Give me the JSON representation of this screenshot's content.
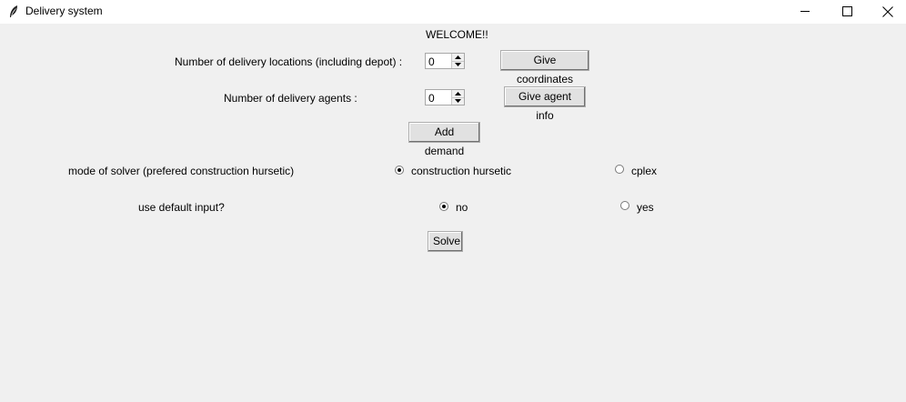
{
  "window": {
    "title": "Delivery system",
    "icon": "feather-icon",
    "controls": [
      "minimize-icon",
      "maximize-icon",
      "close-icon"
    ]
  },
  "welcome": "WELCOME!!",
  "locations": {
    "label": "Number of delivery locations (including depot) :",
    "value": "0",
    "button": "Give coordinates"
  },
  "agents": {
    "label": "Number of delivery agents :",
    "value": "0",
    "button": "Give agent info"
  },
  "add_demand_button": "Add demand",
  "solver_mode": {
    "label": "mode of solver (prefered construction hursetic)",
    "options": [
      {
        "label": "construction hursetic",
        "selected": true
      },
      {
        "label": "cplex",
        "selected": false
      }
    ]
  },
  "default_input": {
    "label": "use default input?",
    "options": [
      {
        "label": "no",
        "selected": true
      },
      {
        "label": "yes",
        "selected": false
      }
    ]
  },
  "solve_button": "Solve"
}
